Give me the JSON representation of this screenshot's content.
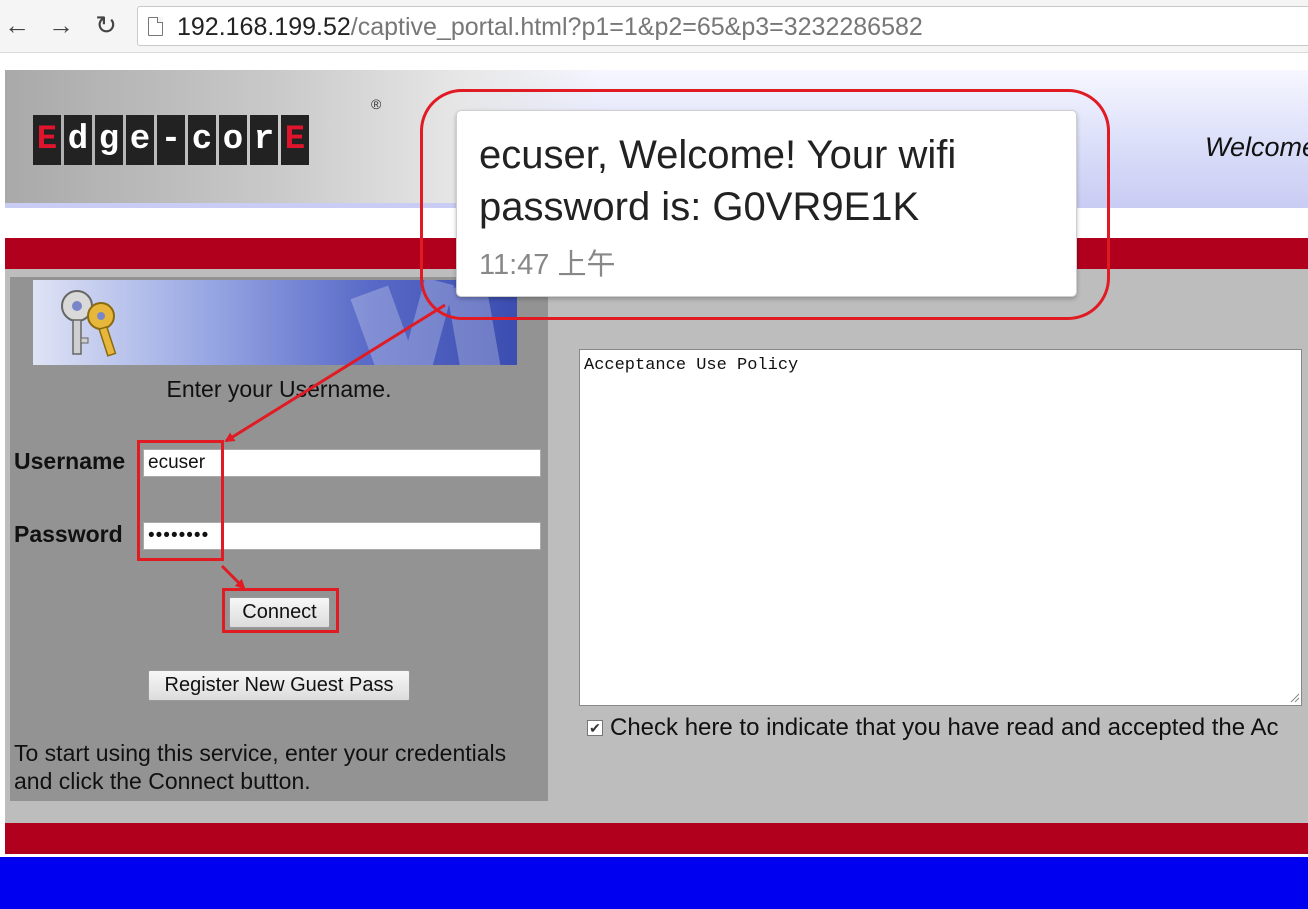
{
  "browser": {
    "url_host": "192.168.199.52",
    "url_path": "/captive_portal.html?p1=1&p2=65&p3=3232286582"
  },
  "header": {
    "logo_letters": [
      "E",
      "d",
      "g",
      "e",
      "-",
      "c",
      "o",
      "r",
      "E"
    ],
    "registered_mark": "®",
    "welcome_text": "Welcome"
  },
  "login": {
    "prompt": "Enter your Username.",
    "username_label": "Username",
    "username_value": "ecuser",
    "password_label": "Password",
    "password_value": "••••••••",
    "connect_label": "Connect",
    "register_label": "Register New Guest Pass",
    "instructions": "To start using this service, enter your credentials and click the Connect button."
  },
  "policy": {
    "aup_text": "Acceptance Use Policy",
    "accept_checked": true,
    "accept_label": "Check here to indicate that you have read and accepted the Ac"
  },
  "notification": {
    "message": "ecuser, Welcome! Your wifi password is: G0VR9E1K",
    "time": "11:47 上午"
  },
  "colors": {
    "annotation_red": "#e01b24",
    "brand_red": "#b0001e",
    "footer_blue": "#0000f0"
  }
}
